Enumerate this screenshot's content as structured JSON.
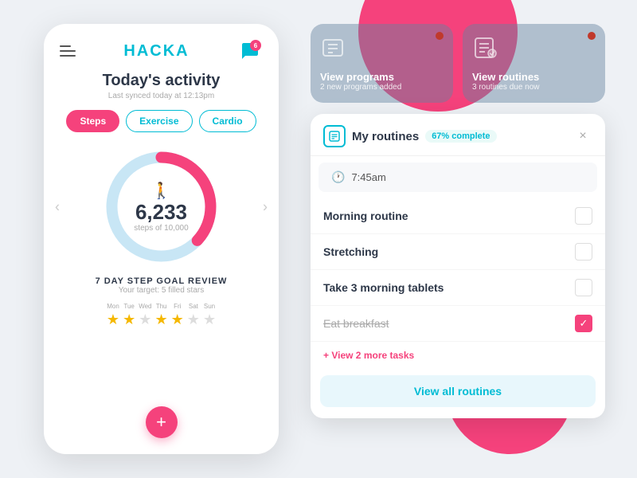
{
  "app": {
    "title": "HACKA",
    "badge_count": "6",
    "activity_title": "Today's activity",
    "sync_text": "Last synced today at 12:13pm",
    "tabs": [
      {
        "label": "Steps",
        "active": true
      },
      {
        "label": "Exercise",
        "active": false
      },
      {
        "label": "Cardio",
        "active": false
      }
    ],
    "steps": {
      "count": "6,233",
      "goal": "steps of 10,000"
    },
    "goal_review": {
      "title": "7 DAY STEP GOAL REVIEW",
      "target": "Your target: 5 filled stars"
    },
    "days": [
      {
        "label": "Mon",
        "filled": true
      },
      {
        "label": "Tue",
        "filled": true
      },
      {
        "label": "Wed",
        "filled": false
      },
      {
        "label": "Thu",
        "filled": true
      },
      {
        "label": "Fri",
        "filled": true
      },
      {
        "label": "Sat",
        "filled": false
      },
      {
        "label": "Sun",
        "filled": false
      }
    ]
  },
  "top_cards": [
    {
      "title": "View programs",
      "sub": "2 new programs added"
    },
    {
      "title": "View routines",
      "sub": "3 routines due now"
    }
  ],
  "routines": {
    "title": "My routines",
    "complete_label": "67% complete",
    "time": "7:45am",
    "tasks": [
      {
        "label": "Morning routine",
        "checked": false,
        "strikethrough": false
      },
      {
        "label": "Stretching",
        "checked": false,
        "strikethrough": false
      },
      {
        "label": "Take 3 morning tablets",
        "checked": false,
        "strikethrough": false
      },
      {
        "label": "Eat breakfast",
        "checked": true,
        "strikethrough": true
      }
    ],
    "view_more": "+ View 2 more tasks",
    "view_all_btn": "View all routines"
  },
  "right_stars": [
    "★",
    "★",
    "★",
    "★",
    "★"
  ]
}
